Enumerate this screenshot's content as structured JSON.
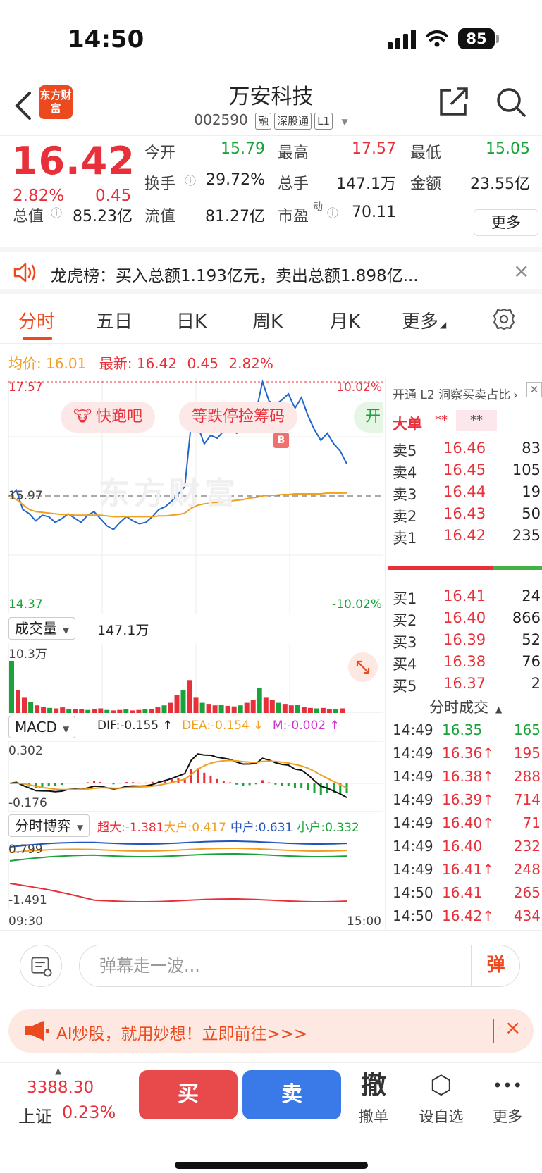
{
  "status": {
    "time": "14:50",
    "battery": "85"
  },
  "header": {
    "logo": "东方财富",
    "title": "万安科技",
    "code": "002590",
    "tags": [
      "融",
      "深股通",
      "L1"
    ]
  },
  "quote": {
    "price": "16.42",
    "change_pct": "2.82%",
    "change_amt": "0.45",
    "fields": {
      "open_label": "今开",
      "open": "15.79",
      "high_label": "最高",
      "high": "17.57",
      "low_label": "最低",
      "low": "15.05",
      "turnover_label": "换手",
      "turnover": "29.72%",
      "volume_label": "总手",
      "volume": "147.1万",
      "amount_label": "金额",
      "amount": "23.55亿",
      "mktcap_label": "总值",
      "mktcap": "85.23亿",
      "float_label": "流值",
      "float": "81.27亿",
      "pe_label": "市盈",
      "pe_sup": "动",
      "pe": "70.11"
    },
    "more_label": "更多"
  },
  "notice": {
    "text": "龙虎榜：买入总额1.193亿元，卖出总额1.898亿..."
  },
  "tabs": [
    "分时",
    "五日",
    "日K",
    "周K",
    "月K",
    "更多"
  ],
  "active_tab": 0,
  "avg_line": {
    "avg_label": "均价:",
    "avg_value": "16.01",
    "latest_label": "最新:",
    "latest_value": "16.42",
    "latest_chg": "0.45",
    "latest_pct": "2.82%"
  },
  "chart_pills": [
    "快跑吧",
    "等跌停捡筹码",
    "开"
  ],
  "watermark": "东方财富",
  "b_marker": "B",
  "chart_data": [
    {
      "type": "line",
      "title": "分时",
      "y_labels": {
        "top": "17.57",
        "mid": "15.97",
        "bottom": "14.37"
      },
      "pct_labels": {
        "top": "10.02%",
        "bottom": "-10.02%"
      },
      "ylim": [
        14.37,
        17.57
      ],
      "prev_close": 15.97,
      "x_labels": [
        "09:30",
        "15:00"
      ],
      "series": [
        {
          "name": "price",
          "values": [
            15.97,
            16.05,
            15.78,
            15.72,
            15.62,
            15.7,
            15.68,
            15.6,
            15.65,
            15.72,
            15.66,
            15.6,
            15.7,
            15.75,
            15.65,
            15.55,
            15.5,
            15.6,
            15.68,
            15.62,
            15.58,
            15.6,
            15.68,
            15.78,
            15.82,
            15.9,
            16.0,
            16.1,
            17.0,
            16.95,
            16.7,
            16.82,
            16.78,
            16.88,
            16.92,
            16.85,
            16.9,
            17.05,
            17.15,
            17.57,
            17.3,
            17.25,
            17.32,
            17.4,
            17.2,
            17.35,
            17.1,
            16.9,
            16.75,
            16.85,
            16.7,
            16.6,
            16.42
          ]
        },
        {
          "name": "avg",
          "values": [
            15.97,
            15.92,
            15.85,
            15.78,
            15.75,
            15.74,
            15.73,
            15.72,
            15.71,
            15.71,
            15.7,
            15.7,
            15.7,
            15.7,
            15.7,
            15.69,
            15.68,
            15.68,
            15.68,
            15.68,
            15.68,
            15.68,
            15.68,
            15.69,
            15.69,
            15.7,
            15.71,
            15.73,
            15.8,
            15.84,
            15.86,
            15.87,
            15.88,
            15.89,
            15.9,
            15.91,
            15.92,
            15.94,
            15.95,
            15.97,
            15.98,
            15.98,
            15.99,
            15.99,
            16.0,
            16.0,
            16.0,
            16.0,
            16.0,
            16.01,
            16.01,
            16.01,
            16.01
          ]
        }
      ]
    },
    {
      "type": "bar",
      "title": "成交量",
      "total": "147.1万",
      "ymax_label": "10.3万",
      "values": [
        10.3,
        4.5,
        3.0,
        2.2,
        1.5,
        1.2,
        1.0,
        0.9,
        1.1,
        0.8,
        0.7,
        0.8,
        0.6,
        0.7,
        0.9,
        0.6,
        0.5,
        0.6,
        0.7,
        0.5,
        0.6,
        0.7,
        0.8,
        1.2,
        1.5,
        2.0,
        3.5,
        4.5,
        6.5,
        3.0,
        2.0,
        1.8,
        1.5,
        1.6,
        1.4,
        1.3,
        1.5,
        2.0,
        2.5,
        5.0,
        3.0,
        2.5,
        2.0,
        1.8,
        1.5,
        1.6,
        1.2,
        1.0,
        0.9,
        1.0,
        0.8,
        0.7,
        0.9
      ]
    },
    {
      "type": "line",
      "title": "MACD",
      "dif_label": "DIF:-0.155 ↑",
      "dea_label": "DEA:-0.154 ↓",
      "m_label": "M:-0.002 ↑",
      "ymax_label": "0.302",
      "ymin_label": "-0.176",
      "ylim": [
        -0.176,
        0.302
      ]
    },
    {
      "type": "line",
      "title": "分时博弈",
      "super_label": "超大:-1.381",
      "large_label": "大户:0.417",
      "mid_label": "中户:0.631",
      "small_label": "小户:0.332",
      "ymax_label": "0.799",
      "ymin_label": "-1.491",
      "ylim": [
        -1.491,
        0.799
      ]
    }
  ],
  "orderbook": {
    "header": "开通 L2 洞察买卖占比",
    "big_label": "大单",
    "big_v1": "**",
    "big_v2": "**",
    "asks": [
      {
        "label": "卖5",
        "price": "16.46",
        "vol": "83"
      },
      {
        "label": "卖4",
        "price": "16.45",
        "vol": "105"
      },
      {
        "label": "卖3",
        "price": "16.44",
        "vol": "19"
      },
      {
        "label": "卖2",
        "price": "16.43",
        "vol": "50"
      },
      {
        "label": "卖1",
        "price": "16.42",
        "vol": "235"
      }
    ],
    "bids": [
      {
        "label": "买1",
        "price": "16.41",
        "vol": "24"
      },
      {
        "label": "买2",
        "price": "16.40",
        "vol": "866"
      },
      {
        "label": "买3",
        "price": "16.39",
        "vol": "52"
      },
      {
        "label": "买4",
        "price": "16.38",
        "vol": "76"
      },
      {
        "label": "买5",
        "price": "16.37",
        "vol": "2"
      }
    ],
    "trades_label": "分时成交",
    "trades": [
      {
        "time": "14:49",
        "price": "16.35",
        "vol": "165",
        "dir": "g"
      },
      {
        "time": "14:49",
        "price": "16.36↑",
        "vol": "195",
        "dir": "r"
      },
      {
        "time": "14:49",
        "price": "16.38↑",
        "vol": "288",
        "dir": "r"
      },
      {
        "time": "14:49",
        "price": "16.39↑",
        "vol": "714",
        "dir": "r"
      },
      {
        "time": "14:49",
        "price": "16.40↑",
        "vol": "71",
        "dir": "r"
      },
      {
        "time": "14:49",
        "price": "16.40",
        "vol": "232",
        "dir": "r"
      },
      {
        "time": "14:49",
        "price": "16.41↑",
        "vol": "248",
        "dir": "r"
      },
      {
        "time": "14:50",
        "price": "16.41",
        "vol": "265",
        "dir": "r"
      },
      {
        "time": "14:50",
        "price": "16.42↑",
        "vol": "434",
        "dir": "r"
      }
    ]
  },
  "comment": {
    "placeholder": "弹幕走一波...",
    "btn": "弹"
  },
  "ad": {
    "text": "AI炒股，就用妙想！立即前往>>>"
  },
  "bottom": {
    "index_value": "3388.30",
    "index_name": "上证",
    "index_pct": "0.23%",
    "buy": "买",
    "sell": "卖",
    "tools": [
      {
        "icon": "撤",
        "label": "撤单"
      },
      {
        "icon": "⬡",
        "label": "设自选"
      },
      {
        "icon": "•••",
        "label": "更多"
      }
    ]
  },
  "colors": {
    "up": "#e8303a",
    "down": "#1aa33a",
    "avg": "#f0a020",
    "price_line": "#2266cc",
    "brand": "#ec4a1e"
  }
}
